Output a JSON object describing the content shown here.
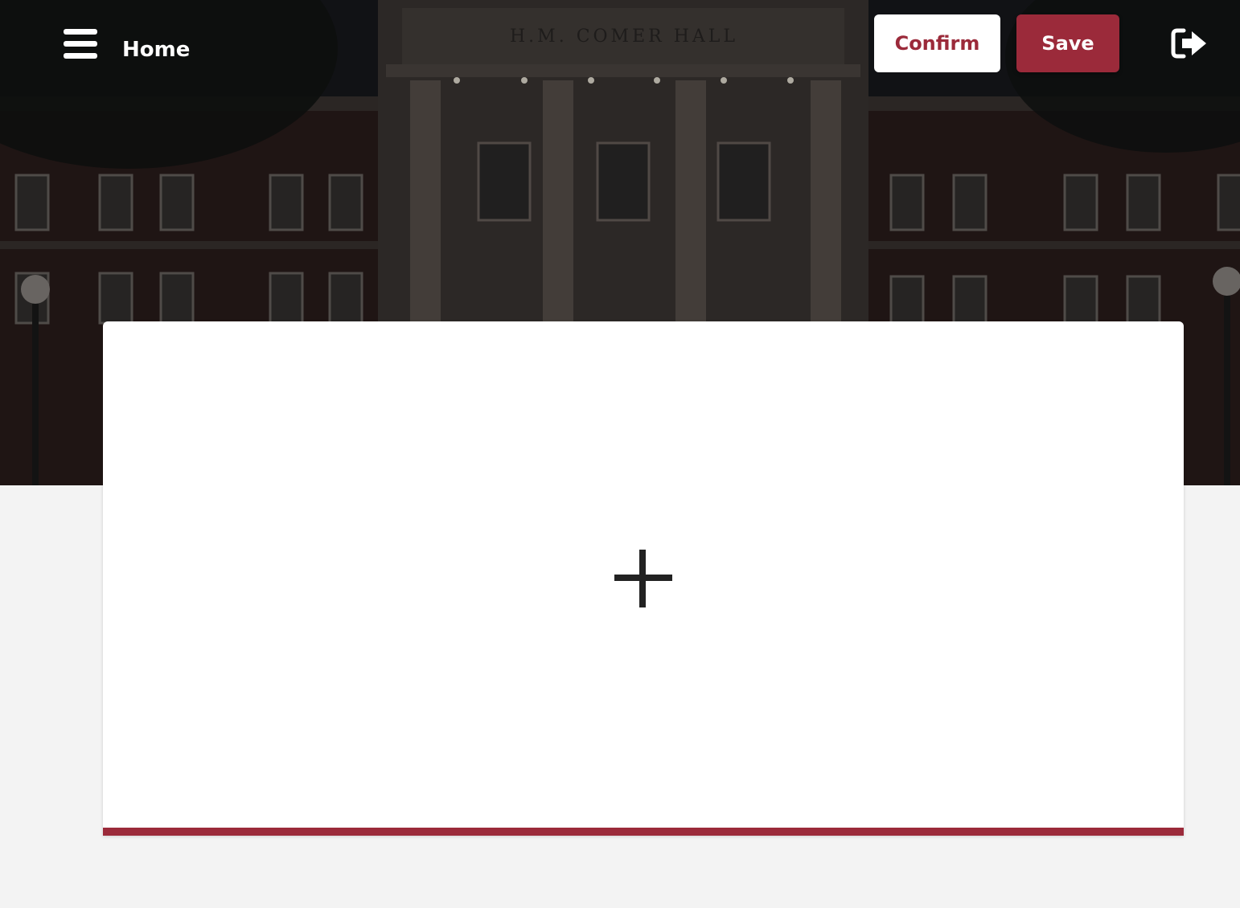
{
  "header": {
    "title": "Home",
    "menu_icon": "hamburger-menu-icon",
    "logout_icon": "sign-out-icon"
  },
  "actions": {
    "confirm_label": "Confirm",
    "save_label": "Save"
  },
  "hero": {
    "building_inscription": "H.M. COMER HALL"
  },
  "card": {
    "add_icon": "plus-icon"
  },
  "colors": {
    "brand": "#9b2a3a",
    "page_background": "#f3f3f3",
    "card_background": "#ffffff"
  }
}
